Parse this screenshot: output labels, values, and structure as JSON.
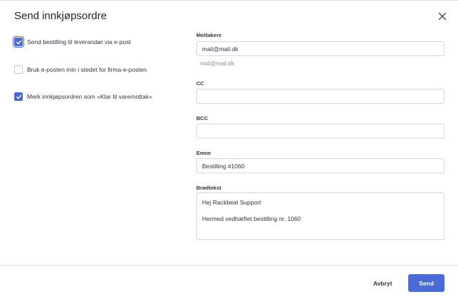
{
  "dialog": {
    "title": "Send innkjøpsordre"
  },
  "options": [
    {
      "label": "Send bestilling til leverandør via e-post",
      "checked": true,
      "focused": true
    },
    {
      "label": "Bruk e-posten min i stedet for firma-e-posten",
      "checked": false,
      "focused": false
    },
    {
      "label": "Merk innkjøpsordren som «Klar til varemottak»",
      "checked": true,
      "focused": false
    }
  ],
  "form": {
    "recipients_label": "Mottakere",
    "recipients_value": "mail@mail.dk",
    "recipients_suggestion": "mail@mail.dk",
    "cc_label": "CC",
    "cc_value": "",
    "bcc_label": "BCC",
    "bcc_value": "",
    "subject_label": "Emne",
    "subject_value": "Bestilling #1060",
    "body_label": "Brødtekst",
    "body_line1": "Hej Rackbeat Support",
    "body_line2": "Hermed vedhæftet bestilling nr. 1060"
  },
  "footer": {
    "cancel_label": "Avbryt",
    "send_label": "Send"
  },
  "colors": {
    "accent": "#4a6bd6",
    "border": "#d3d7dd"
  },
  "icons": {
    "close": "close-icon",
    "check": "check-icon"
  }
}
